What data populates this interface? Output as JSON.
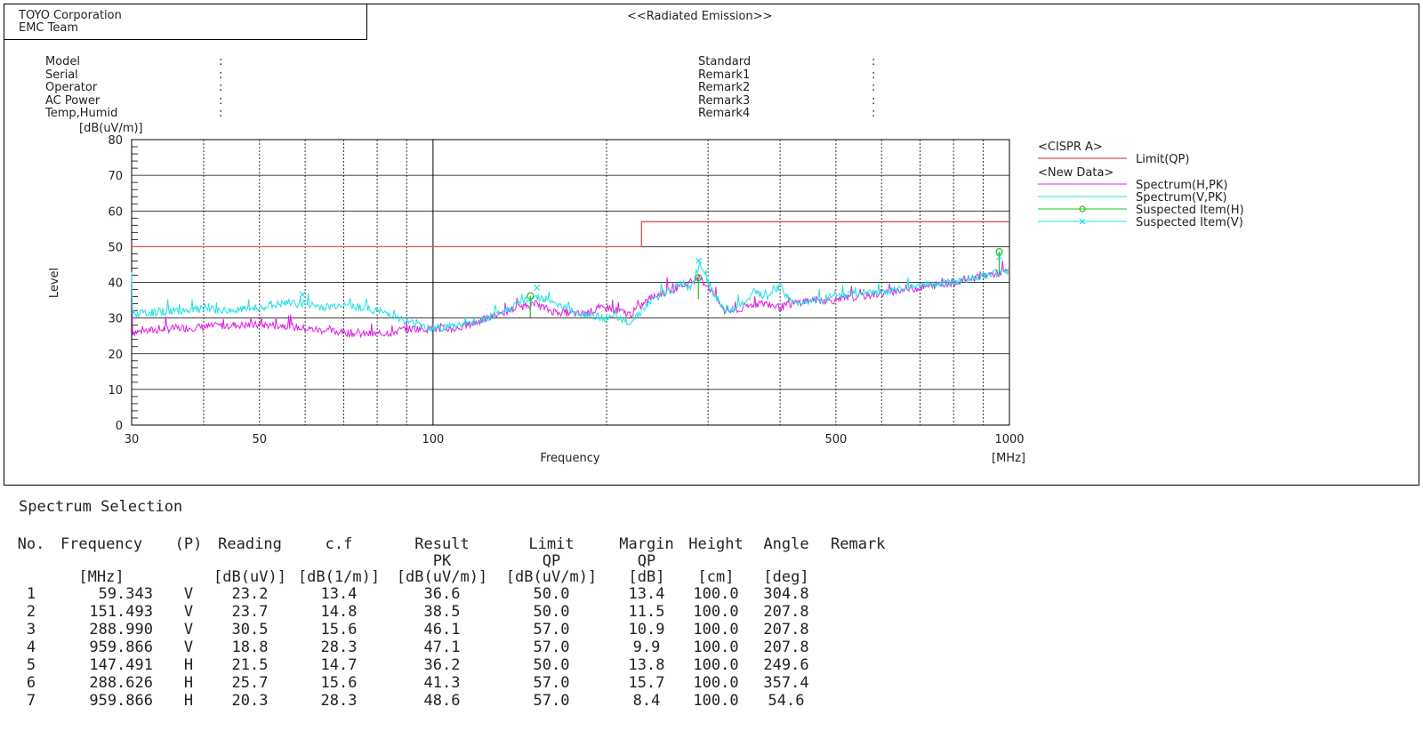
{
  "org": {
    "line1": "TOYO Corporation",
    "line2": "EMC Team"
  },
  "report_title": "<<Radiated Emission>>",
  "meta_left": [
    {
      "label": "Model",
      "value": ":"
    },
    {
      "label": "Serial",
      "value": ":"
    },
    {
      "label": "Operator",
      "value": ":"
    },
    {
      "label": "AC Power",
      "value": ":"
    },
    {
      "label": "Temp,Humid",
      "value": ":"
    }
  ],
  "meta_right": [
    {
      "label": "Standard",
      "value": ":"
    },
    {
      "label": "Remark1",
      "value": ":"
    },
    {
      "label": "Remark2",
      "value": ":"
    },
    {
      "label": "Remark3",
      "value": ":"
    },
    {
      "label": "Remark4",
      "value": ":"
    }
  ],
  "chart_data": {
    "type": "line",
    "xlabel": "Frequency",
    "xunit": "[MHz]",
    "ylabel": "Level",
    "yunit": "[dB(uV/m)]",
    "xscale": "log",
    "xlim": [
      30,
      1000
    ],
    "ylim": [
      0,
      80
    ],
    "xticks": [
      30,
      50,
      100,
      500,
      1000
    ],
    "yticks": [
      0,
      10,
      20,
      30,
      40,
      50,
      60,
      70,
      80
    ],
    "grid": true,
    "legend_position": "right",
    "legend": {
      "group1": "<CISPR A>",
      "group2": "<New Data>",
      "items": [
        {
          "name": "Limit(QP)",
          "color": "#e05050"
        },
        {
          "name": "Spectrum(H,PK)",
          "color": "#e020e0"
        },
        {
          "name": "Spectrum(V,PK)",
          "color": "#20e0e0"
        },
        {
          "name": "Suspected Item(H)",
          "color": "#20c020",
          "marker": "circle"
        },
        {
          "name": "Suspected Item(V)",
          "color": "#20e0e0",
          "marker": "x"
        }
      ]
    },
    "limit_qp": {
      "x": [
        30,
        230,
        230,
        1000
      ],
      "y": [
        50,
        50,
        57,
        57
      ]
    },
    "spectrum_h": {
      "x": [
        30,
        35,
        40,
        45,
        50,
        55,
        60,
        65,
        70,
        75,
        80,
        85,
        90,
        95,
        100,
        110,
        120,
        130,
        140,
        150,
        160,
        180,
        200,
        220,
        240,
        260,
        280,
        290,
        300,
        320,
        340,
        360,
        380,
        400,
        420,
        450,
        500,
        550,
        600,
        700,
        800,
        900,
        1000
      ],
      "y": [
        26,
        27,
        27.5,
        28,
        28,
        28,
        27,
        26.5,
        26,
        25.5,
        25.5,
        26,
        27,
        27,
        27,
        27,
        29,
        31,
        33,
        34,
        32,
        31,
        33,
        31,
        36,
        38,
        40,
        41,
        39,
        32,
        32,
        34,
        34,
        33,
        34,
        35,
        35,
        36,
        37,
        38.5,
        40,
        42,
        43
      ]
    },
    "spectrum_v": {
      "x": [
        30,
        35,
        40,
        45,
        50,
        55,
        60,
        65,
        70,
        75,
        80,
        85,
        90,
        95,
        100,
        110,
        120,
        130,
        140,
        150,
        160,
        180,
        200,
        220,
        240,
        260,
        270,
        280,
        290,
        300,
        320,
        340,
        360,
        380,
        400,
        420,
        450,
        500,
        550,
        600,
        700,
        800,
        900,
        1000
      ],
      "y": [
        31,
        32,
        32.5,
        32,
        33,
        34,
        34,
        33,
        34,
        33,
        32,
        31,
        29,
        28,
        27,
        28,
        29,
        31,
        34,
        36,
        35,
        31,
        30,
        29,
        35,
        38,
        40,
        38,
        45,
        40,
        32,
        33,
        37,
        36,
        39,
        34,
        35,
        36,
        37,
        37,
        39,
        40,
        42,
        43
      ]
    },
    "suspected_h": {
      "x": [
        147.491,
        288.626,
        959.866
      ],
      "y": [
        36.2,
        41.3,
        48.6
      ]
    },
    "suspected_v": {
      "x": [
        59.343,
        151.493,
        288.99,
        959.866
      ],
      "y": [
        36.6,
        38.5,
        46.1,
        47.1
      ]
    }
  },
  "table": {
    "title": "Spectrum Selection",
    "headers": {
      "no": "No.",
      "freq": "Frequency",
      "p": "(P)",
      "reading": "Reading",
      "cf": "c.f",
      "result": "Result",
      "limit": "Limit",
      "margin": "Margin",
      "height": "Height",
      "angle": "Angle",
      "remark": "Remark"
    },
    "sub_headers": {
      "result": "PK",
      "limit": "QP",
      "margin": "QP"
    },
    "units": {
      "freq": "[MHz]",
      "reading": "[dB(uV)]",
      "cf": "[dB(1/m)]",
      "result": "[dB(uV/m)]",
      "limit": "[dB(uV/m)]",
      "margin": "[dB]",
      "height": "[cm]",
      "angle": "[deg]"
    },
    "rows": [
      {
        "no": "1",
        "freq": "59.343",
        "p": "V",
        "reading": "23.2",
        "cf": "13.4",
        "result": "36.6",
        "limit": "50.0",
        "margin": "13.4",
        "height": "100.0",
        "angle": "304.8"
      },
      {
        "no": "2",
        "freq": "151.493",
        "p": "V",
        "reading": "23.7",
        "cf": "14.8",
        "result": "38.5",
        "limit": "50.0",
        "margin": "11.5",
        "height": "100.0",
        "angle": "207.8"
      },
      {
        "no": "3",
        "freq": "288.990",
        "p": "V",
        "reading": "30.5",
        "cf": "15.6",
        "result": "46.1",
        "limit": "57.0",
        "margin": "10.9",
        "height": "100.0",
        "angle": "207.8"
      },
      {
        "no": "4",
        "freq": "959.866",
        "p": "V",
        "reading": "18.8",
        "cf": "28.3",
        "result": "47.1",
        "limit": "57.0",
        "margin": "9.9",
        "height": "100.0",
        "angle": "207.8"
      },
      {
        "no": "5",
        "freq": "147.491",
        "p": "H",
        "reading": "21.5",
        "cf": "14.7",
        "result": "36.2",
        "limit": "50.0",
        "margin": "13.8",
        "height": "100.0",
        "angle": "249.6"
      },
      {
        "no": "6",
        "freq": "288.626",
        "p": "H",
        "reading": "25.7",
        "cf": "15.6",
        "result": "41.3",
        "limit": "57.0",
        "margin": "15.7",
        "height": "100.0",
        "angle": "357.4"
      },
      {
        "no": "7",
        "freq": "959.866",
        "p": "H",
        "reading": "20.3",
        "cf": "28.3",
        "result": "48.6",
        "limit": "57.0",
        "margin": "8.4",
        "height": "100.0",
        "angle": "54.6"
      }
    ]
  }
}
